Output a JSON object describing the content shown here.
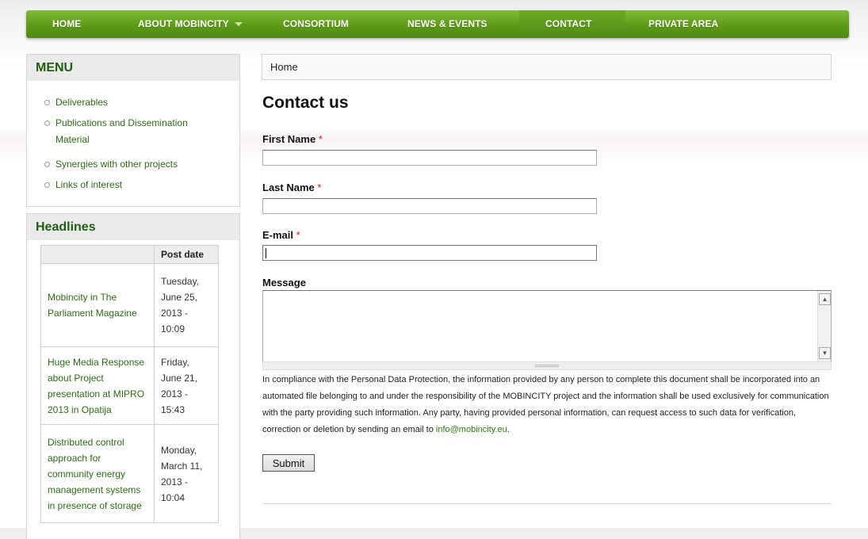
{
  "nav": {
    "items": [
      {
        "label": "HOME"
      },
      {
        "label": "ABOUT MOBINCITY"
      },
      {
        "label": "CONSORTIUM"
      },
      {
        "label": "NEWS & EVENTS"
      },
      {
        "label": "CONTACT"
      },
      {
        "label": "PRIVATE AREA"
      }
    ],
    "active": "CONTACT"
  },
  "menu": {
    "title": "MENU",
    "items": [
      {
        "label": "Deliverables"
      },
      {
        "label": "Publications and Dissemination Material"
      },
      {
        "label": "Synergies with other projects"
      },
      {
        "label": "Links of interest"
      }
    ]
  },
  "headlines": {
    "title": "Headlines",
    "columns": [
      "",
      "Post date"
    ],
    "rows": [
      {
        "title": "Mobincity in The Parliament Magazine",
        "date": "Tuesday, June 25, 2013 - 10:09"
      },
      {
        "title": "Huge Media Response about Project presentation at MIPRO 2013 in Opatija",
        "date": "Friday, June 21, 2013 - 15:43"
      },
      {
        "title": "Distributed control approach for community energy management systems in presence of storage",
        "date": "Monday, March 11, 2013 - 10:04"
      }
    ]
  },
  "breadcrumb": {
    "label": "Home"
  },
  "page": {
    "title": "Contact us"
  },
  "form": {
    "first_name": {
      "label": "First Name",
      "required_mark": "*",
      "value": ""
    },
    "last_name": {
      "label": "Last Name",
      "required_mark": "*",
      "value": ""
    },
    "email": {
      "label": "E-mail",
      "required_mark": "*",
      "value": ""
    },
    "message": {
      "label": "Message",
      "value": ""
    },
    "notice_text": "In compliance with the Personal Data Protection, the information provided by any person to complete this document shall be incorporated into an automated file belonging to and under the responsibility of the MOBINCITY project and the information shall be used exclusively for communication with the party providing such information. Any party, having provided personal information, can request access to such data for verification, correction or deletion by sending an email to ",
    "notice_email": "info@mobincity.eu",
    "notice_end": ".",
    "submit_label": "Submit"
  },
  "colors": {
    "nav_green": "#5c9a17",
    "link_green": "#2f6a18",
    "required_red": "#d11111"
  }
}
